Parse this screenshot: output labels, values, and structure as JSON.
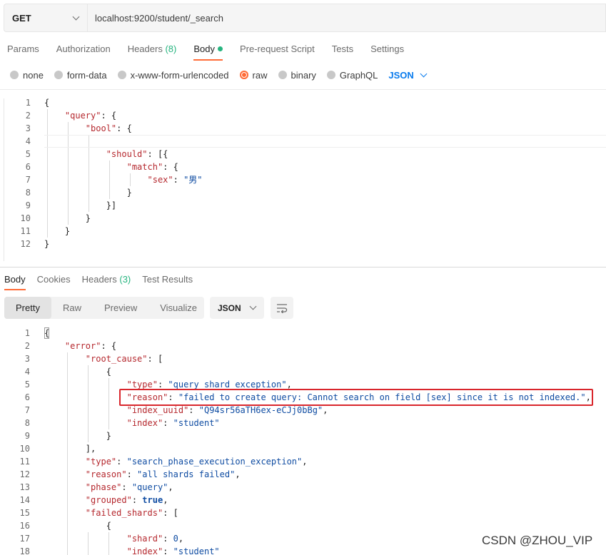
{
  "request": {
    "method": "GET",
    "url": "localhost:9200/student/_search"
  },
  "request_tabs": {
    "params": "Params",
    "authorization": "Authorization",
    "headers": "Headers",
    "headers_count": "(8)",
    "body": "Body",
    "prerequest": "Pre-request Script",
    "tests": "Tests",
    "settings": "Settings"
  },
  "body_types": {
    "none": "none",
    "form_data": "form-data",
    "urlencoded": "x-www-form-urlencoded",
    "raw": "raw",
    "binary": "binary",
    "graphql": "GraphQL",
    "format": "JSON",
    "selected": "raw"
  },
  "request_body": {
    "line_numbers": [
      "1",
      "2",
      "3",
      "4",
      "5",
      "6",
      "7",
      "8",
      "9",
      "10",
      "11",
      "12"
    ],
    "keys": {
      "query": "\"query\"",
      "bool": "\"bool\"",
      "should": "\"should\"",
      "match": "\"match\"",
      "sex": "\"sex\""
    },
    "values": {
      "sex": "\"男\""
    }
  },
  "response_tabs": {
    "body": "Body",
    "cookies": "Cookies",
    "headers": "Headers",
    "headers_count": "(3)",
    "test_results": "Test Results"
  },
  "view_modes": {
    "pretty": "Pretty",
    "raw": "Raw",
    "preview": "Preview",
    "visualize": "Visualize",
    "format": "JSON"
  },
  "response_body": {
    "line_numbers": [
      "1",
      "2",
      "3",
      "4",
      "5",
      "6",
      "7",
      "8",
      "9",
      "10",
      "11",
      "12",
      "13",
      "14",
      "15",
      "16",
      "17",
      "18"
    ],
    "keys": {
      "error": "\"error\"",
      "root_cause": "\"root_cause\"",
      "type": "\"type\"",
      "reason": "\"reason\"",
      "index_uuid": "\"index_uuid\"",
      "index": "\"index\"",
      "phase": "\"phase\"",
      "grouped": "\"grouped\"",
      "failed_shards": "\"failed_shards\"",
      "shard": "\"shard\""
    },
    "values": {
      "root_type": "\"query_shard_exception\"",
      "root_reason": "\"failed to create query: Cannot search on field [sex] since it is not indexed.\"",
      "index_uuid": "\"Q94sr56aTH6ex-eCJj0bBg\"",
      "index": "\"student\"",
      "type": "\"search_phase_execution_exception\"",
      "reason": "\"all shards failed\"",
      "phase": "\"query\"",
      "grouped": "true",
      "shard": "0",
      "shard_index": "\"student\""
    }
  },
  "watermark": "CSDN @ZHOU_VIP",
  "colors": {
    "accent": "#ff6c37",
    "json_key": "#b5282e",
    "json_string": "#0f4ca2",
    "link_blue": "#097bed",
    "highlight_red": "#d9262c",
    "success_green": "#26b47f"
  }
}
